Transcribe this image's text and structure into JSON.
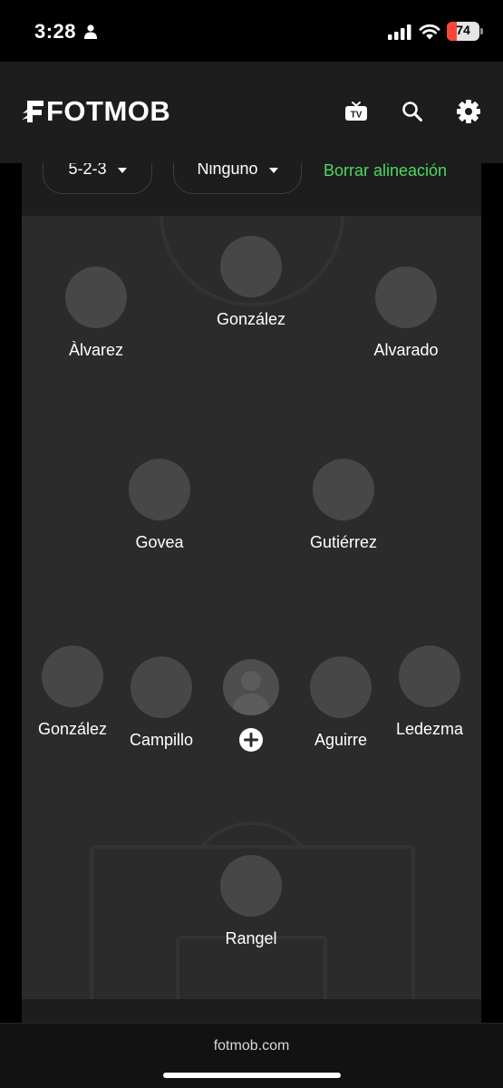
{
  "status_bar": {
    "time": "3:28",
    "battery_level": "74",
    "battery_fraction": 0.3,
    "icons": [
      "person-icon",
      "signal-icon",
      "wifi-icon",
      "battery-icon"
    ]
  },
  "header": {
    "logo_text": "FOTMOB",
    "icons": [
      "tv-icon",
      "search-icon",
      "gear-icon"
    ]
  },
  "controls": {
    "formation": "5-2-3",
    "captain": "Ninguno",
    "clear_label": "Borrar alineación",
    "clear_color": "#4cd964"
  },
  "lineup": {
    "attackers": [
      {
        "name": "Àlvarez"
      },
      {
        "name": "González"
      },
      {
        "name": "Alvarado"
      }
    ],
    "midfielders": [
      {
        "name": "Govea"
      },
      {
        "name": "Gutiérrez"
      }
    ],
    "defenders": [
      {
        "name": "González"
      },
      {
        "name": "Campillo"
      },
      {
        "name": "Aguirre"
      },
      {
        "name": "Ledezma"
      }
    ],
    "goalkeeper": {
      "name": "Rangel"
    },
    "empty_slot_icon": "plus-icon"
  },
  "browser": {
    "url": "fotmob.com"
  },
  "colors": {
    "background": "#000000",
    "header": "#1d1d1d",
    "pitch": "#2b2b2b",
    "accent": "#4cd964"
  }
}
